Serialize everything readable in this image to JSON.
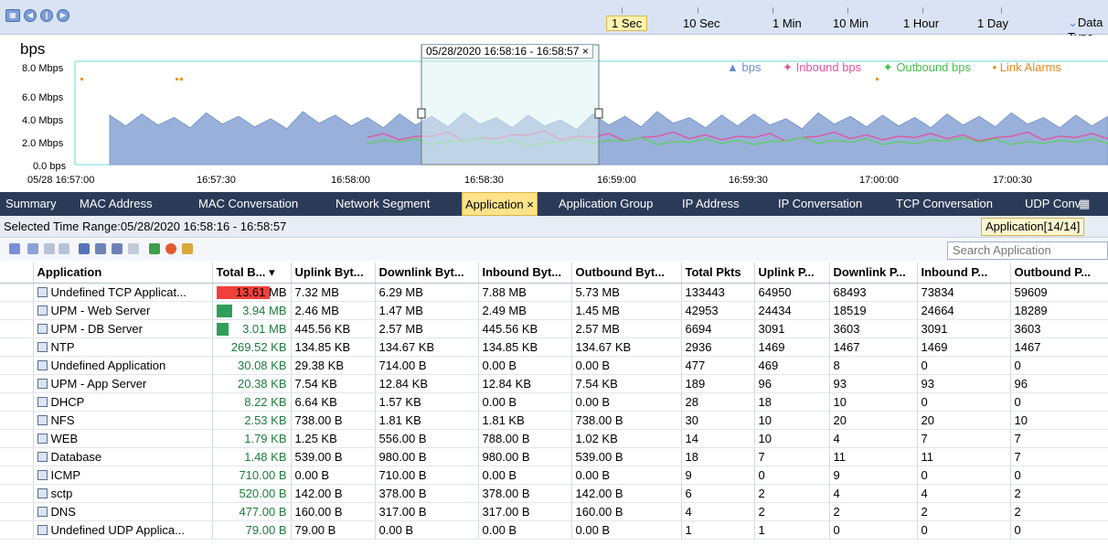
{
  "toolbar": {
    "icons": [
      "calendar-icon",
      "prev-icon",
      "pause-icon",
      "next-icon"
    ]
  },
  "timescale": {
    "items": [
      "1 Sec",
      "10 Sec",
      "1 Min",
      "10 Min",
      "1 Hour",
      "1 Day"
    ],
    "active": "1 Sec",
    "data_type_label": "Data Type"
  },
  "chart_data": {
    "type": "area",
    "title": "",
    "ylabel": "bps",
    "ytick_labels": [
      "8.0 Mbps",
      "6.0 Mbps",
      "4.0 Mbps",
      "2.0 Mbps",
      "0.0 bps"
    ],
    "xtick_labels": [
      "05/28 16:57:00",
      "16:57:30",
      "16:58:00",
      "16:58:30",
      "16:59:00",
      "16:59:30",
      "17:00:00",
      "17:00:30"
    ],
    "ylim": [
      0,
      8.0
    ],
    "yunit": "Mbps",
    "selected_range": "05/28/2020  16:58:16 - 16:58:57",
    "legend": [
      "bps",
      "Inbound bps",
      "Outbound bps",
      "Link Alarms"
    ],
    "colors": {
      "bps": "#8ea7d6",
      "inbound": "#e2559c",
      "outbound": "#5fcf63",
      "alarm": "#f0932b"
    },
    "series": [
      {
        "name": "bps",
        "values": [
          4.2,
          4.3,
          4.0,
          4.4,
          4.1,
          3.9,
          4.5,
          4.2,
          4.0,
          4.3,
          4.1,
          4.4,
          4.0,
          4.2,
          3.8,
          4.3,
          4.1,
          4.5,
          4.0,
          4.2,
          4.3,
          3.9,
          4.4,
          4.1,
          4.2,
          4.0,
          4.3,
          4.1,
          4.4,
          4.0,
          4.2,
          4.1
        ]
      },
      {
        "name": "Inbound bps",
        "values": [
          0,
          0,
          0,
          0,
          0,
          0,
          0,
          0,
          2.3,
          2.1,
          2.4,
          2.0,
          2.2,
          2.5,
          2.1,
          2.3,
          2.0,
          2.4,
          2.2,
          2.1,
          2.3,
          2.0,
          2.4,
          2.2,
          2.1,
          2.3,
          2.2,
          2.0,
          2.4,
          2.1,
          2.3,
          2.2
        ]
      },
      {
        "name": "Outbound bps",
        "values": [
          0,
          0,
          0,
          0,
          0,
          0,
          0,
          0,
          1.8,
          1.9,
          1.7,
          2.0,
          1.8,
          1.6,
          1.9,
          1.8,
          2.0,
          1.7,
          1.9,
          1.8,
          1.7,
          2.0,
          1.8,
          1.9,
          1.7,
          1.8,
          2.0,
          1.9,
          1.7,
          1.8,
          1.9,
          1.8
        ]
      }
    ]
  },
  "tabs": [
    "Summary",
    "MAC Address",
    "MAC Conversation",
    "Network Segment",
    "Application",
    "Application Group",
    "IP Address",
    "IP Conversation",
    "TCP Conversation",
    "UDP Conv"
  ],
  "active_tab": "Application",
  "range_bar": {
    "text": "Selected Time Range:05/28/2020  16:58:16 - 16:58:57",
    "app_count": "Application[14/14]"
  },
  "search": {
    "placeholder": "Search Application"
  },
  "table": {
    "headers": [
      "Application",
      "Total B...",
      "Uplink Byt...",
      "Downlink Byt...",
      "Inbound Byt...",
      "Outbound Byt...",
      "Total Pkts",
      "Uplink P...",
      "Downlink P...",
      "Inbound P...",
      "Outbound P..."
    ],
    "rows": [
      {
        "name": "Undefined TCP Applicat...",
        "total": "13.61 MB",
        "bar": 1.0,
        "up": "7.32 MB",
        "down": "6.29 MB",
        "in": "7.88 MB",
        "out": "5.73 MB",
        "pkts": "133443",
        "upp": "64950",
        "downp": "68493",
        "inp": "73834",
        "outp": "59609"
      },
      {
        "name": "UPM - Web Server",
        "total": "3.94 MB",
        "bar": 0.29,
        "up": "2.46 MB",
        "down": "1.47 MB",
        "in": "2.49 MB",
        "out": "1.45 MB",
        "pkts": "42953",
        "upp": "24434",
        "downp": "18519",
        "inp": "24664",
        "outp": "18289"
      },
      {
        "name": "UPM - DB Server",
        "total": "3.01 MB",
        "bar": 0.22,
        "up": "445.56 KB",
        "down": "2.57 MB",
        "in": "445.56 KB",
        "out": "2.57 MB",
        "pkts": "6694",
        "upp": "3091",
        "downp": "3603",
        "inp": "3091",
        "outp": "3603"
      },
      {
        "name": "NTP",
        "total": "269.52 KB",
        "bar": 0,
        "up": "134.85 KB",
        "down": "134.67 KB",
        "in": "134.85 KB",
        "out": "134.67 KB",
        "pkts": "2936",
        "upp": "1469",
        "downp": "1467",
        "inp": "1469",
        "outp": "1467"
      },
      {
        "name": "Undefined Application",
        "total": "30.08 KB",
        "bar": 0,
        "up": "29.38 KB",
        "down": "714.00 B",
        "in": "0.00 B",
        "out": "0.00 B",
        "pkts": "477",
        "upp": "469",
        "downp": "8",
        "inp": "0",
        "outp": "0"
      },
      {
        "name": "UPM - App Server",
        "total": "20.38 KB",
        "bar": 0,
        "up": "7.54 KB",
        "down": "12.84 KB",
        "in": "12.84 KB",
        "out": "7.54 KB",
        "pkts": "189",
        "upp": "96",
        "downp": "93",
        "inp": "93",
        "outp": "96"
      },
      {
        "name": "DHCP",
        "total": "8.22 KB",
        "bar": 0,
        "up": "6.64 KB",
        "down": "1.57 KB",
        "in": "0.00 B",
        "out": "0.00 B",
        "pkts": "28",
        "upp": "18",
        "downp": "10",
        "inp": "0",
        "outp": "0"
      },
      {
        "name": "NFS",
        "total": "2.53 KB",
        "bar": 0,
        "up": "738.00 B",
        "down": "1.81 KB",
        "in": "1.81 KB",
        "out": "738.00 B",
        "pkts": "30",
        "upp": "10",
        "downp": "20",
        "inp": "20",
        "outp": "10"
      },
      {
        "name": "WEB",
        "total": "1.79 KB",
        "bar": 0,
        "up": "1.25 KB",
        "down": "556.00 B",
        "in": "788.00 B",
        "out": "1.02 KB",
        "pkts": "14",
        "upp": "10",
        "downp": "4",
        "inp": "7",
        "outp": "7"
      },
      {
        "name": "Database",
        "total": "1.48 KB",
        "bar": 0,
        "up": "539.00 B",
        "down": "980.00 B",
        "in": "980.00 B",
        "out": "539.00 B",
        "pkts": "18",
        "upp": "7",
        "downp": "11",
        "inp": "11",
        "outp": "7"
      },
      {
        "name": "ICMP",
        "total": "710.00 B",
        "bar": 0,
        "up": "0.00 B",
        "down": "710.00 B",
        "in": "0.00 B",
        "out": "0.00 B",
        "pkts": "9",
        "upp": "0",
        "downp": "9",
        "inp": "0",
        "outp": "0"
      },
      {
        "name": "sctp",
        "total": "520.00 B",
        "bar": 0,
        "up": "142.00 B",
        "down": "378.00 B",
        "in": "378.00 B",
        "out": "142.00 B",
        "pkts": "6",
        "upp": "2",
        "downp": "4",
        "inp": "4",
        "outp": "2"
      },
      {
        "name": "DNS",
        "total": "477.00 B",
        "bar": 0,
        "up": "160.00 B",
        "down": "317.00 B",
        "in": "317.00 B",
        "out": "160.00 B",
        "pkts": "4",
        "upp": "2",
        "downp": "2",
        "inp": "2",
        "outp": "2"
      },
      {
        "name": "Undefined UDP Applica...",
        "total": "79.00 B",
        "bar": 0,
        "up": "79.00 B",
        "down": "0.00 B",
        "in": "0.00 B",
        "out": "0.00 B",
        "pkts": "1",
        "upp": "1",
        "downp": "0",
        "inp": "0",
        "outp": "0"
      }
    ]
  }
}
